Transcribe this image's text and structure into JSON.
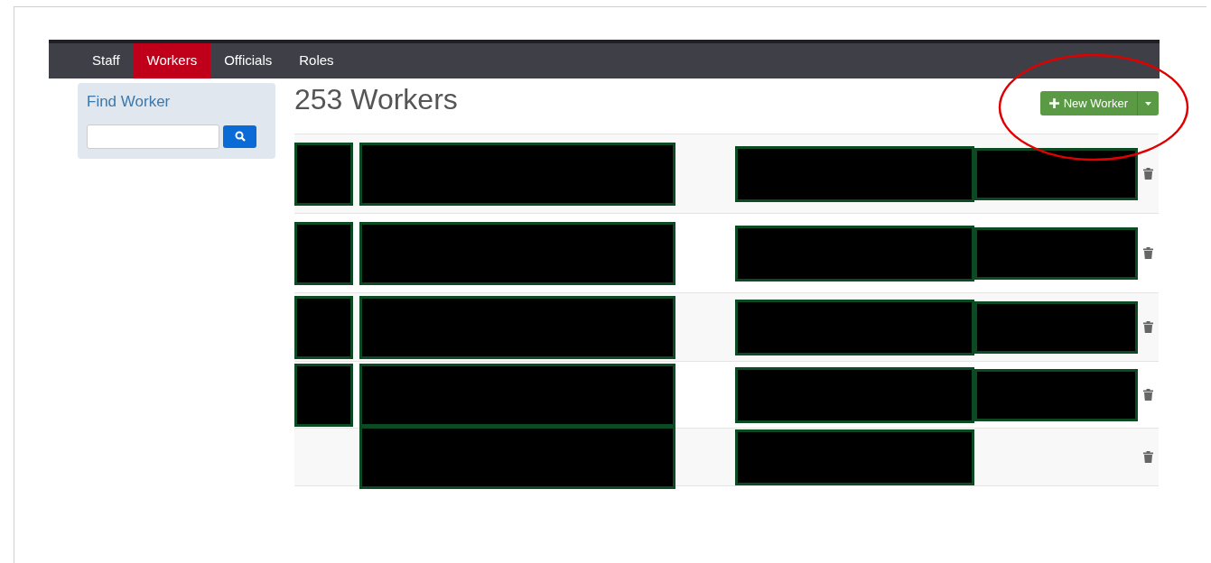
{
  "nav": {
    "tabs": [
      {
        "label": "Staff",
        "selected": false
      },
      {
        "label": "Workers",
        "selected": true
      },
      {
        "label": "Officials",
        "selected": false
      },
      {
        "label": "Roles",
        "selected": false
      }
    ]
  },
  "sidebar": {
    "title": "Find Worker"
  },
  "heading": "253 Workers",
  "new_button": {
    "label": "New Worker"
  },
  "rows": [
    {
      "photo_redacted": true,
      "extra_redacted": true
    },
    {
      "photo_redacted": true,
      "extra_redacted": true
    },
    {
      "photo_redacted": true,
      "extra_redacted": true
    },
    {
      "photo_redacted": true,
      "extra_redacted": true
    },
    {
      "photo_redacted": false,
      "extra_redacted": false
    }
  ]
}
